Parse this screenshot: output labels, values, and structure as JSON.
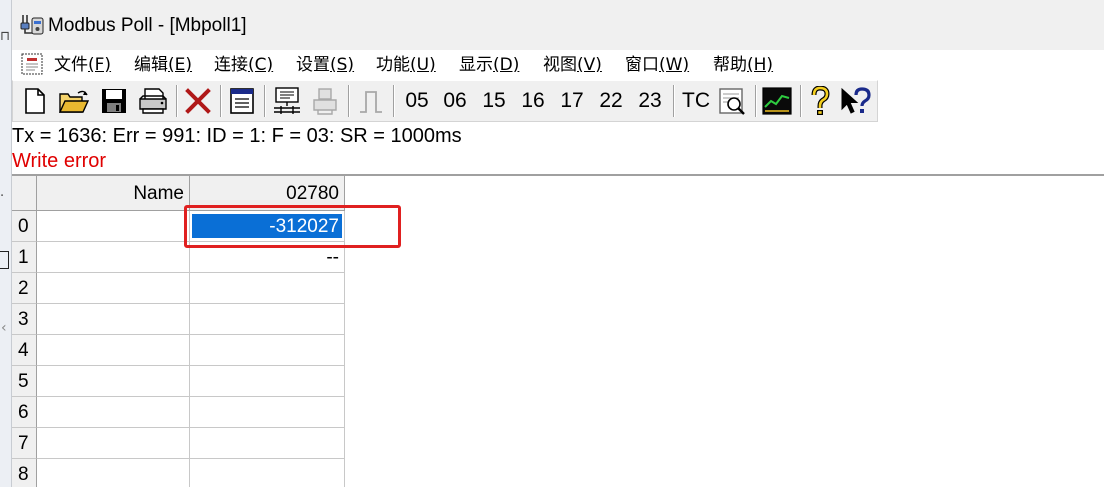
{
  "window": {
    "title": "Modbus Poll - [Mbpoll1]"
  },
  "menu": [
    {
      "label": "文件",
      "accel": "(F)"
    },
    {
      "label": "编辑",
      "accel": "(E)"
    },
    {
      "label": "连接",
      "accel": "(C)"
    },
    {
      "label": "设置",
      "accel": "(S)"
    },
    {
      "label": "功能",
      "accel": "(U)"
    },
    {
      "label": "显示",
      "accel": "(D)"
    },
    {
      "label": "视图",
      "accel": "(V)"
    },
    {
      "label": "窗口",
      "accel": "(W)"
    },
    {
      "label": "帮助",
      "accel": "(H)"
    }
  ],
  "toolbar": {
    "icons": [
      "new-icon",
      "open-icon",
      "save-icon",
      "print-icon",
      "close-x-icon",
      "window-icon",
      "connect-icon",
      "disconnect-icon",
      "pulse-icon",
      "communication-icon",
      "chart-icon",
      "help-icon",
      "context-help-icon"
    ],
    "function_codes": [
      "05",
      "06",
      "15",
      "16",
      "17",
      "22",
      "23"
    ],
    "tc_label": "TC"
  },
  "status": {
    "line": "Tx = 1636: Err = 991: ID = 1: F = 03: SR = 1000ms",
    "error": "Write error",
    "error_color": "#e00000"
  },
  "grid": {
    "name_header": "Name",
    "address_header": "02780",
    "rows": [
      {
        "index": "0",
        "name": "",
        "value": "-312027"
      },
      {
        "index": "1",
        "name": "",
        "value": "--"
      },
      {
        "index": "2",
        "name": "",
        "value": ""
      },
      {
        "index": "3",
        "name": "",
        "value": ""
      },
      {
        "index": "4",
        "name": "",
        "value": ""
      },
      {
        "index": "5",
        "name": "",
        "value": ""
      },
      {
        "index": "6",
        "name": "",
        "value": ""
      },
      {
        "index": "7",
        "name": "",
        "value": ""
      },
      {
        "index": "8",
        "name": "",
        "value": ""
      }
    ],
    "selected_color": "#0a6fd6",
    "highlight_color": "#e02020"
  }
}
